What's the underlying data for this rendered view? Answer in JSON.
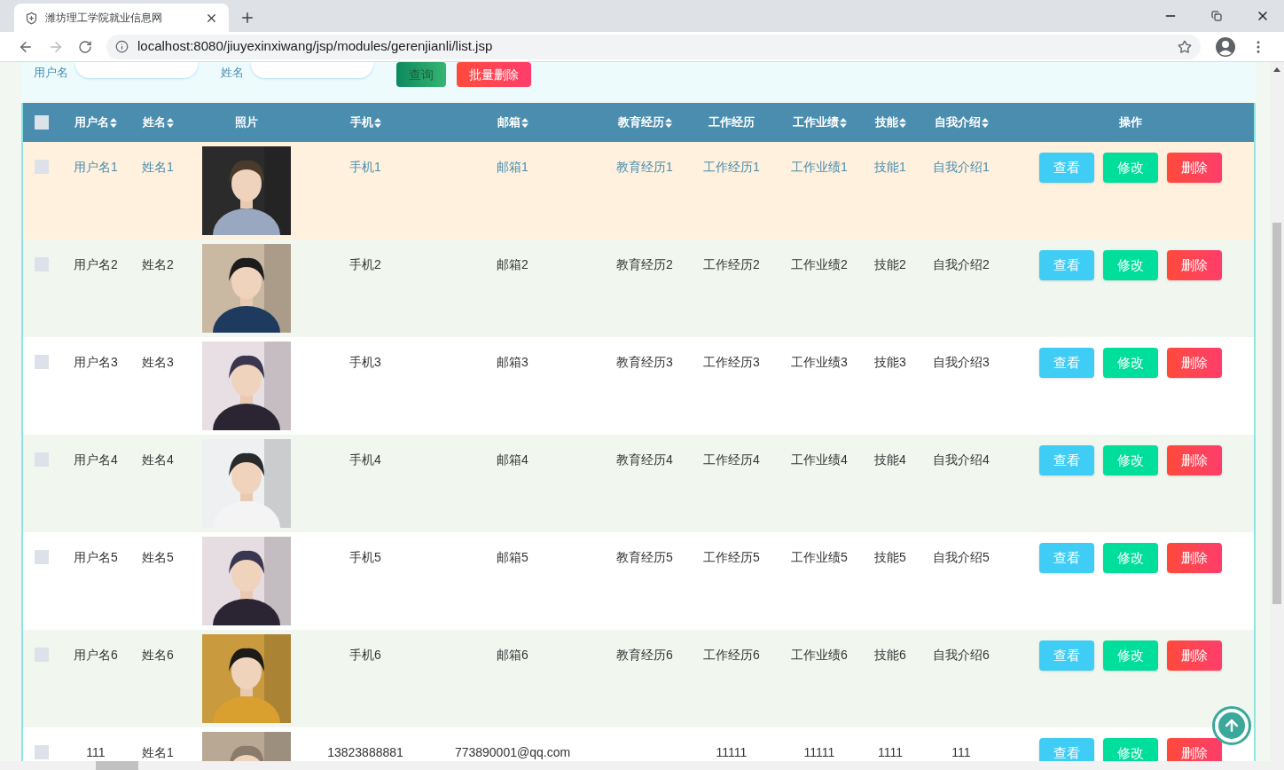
{
  "browser": {
    "tab_title": "潍坊理工学院就业信息网",
    "url": "localhost:8080/jiuyexinxiwang/jsp/modules/gerenjianli/list.jsp"
  },
  "search": {
    "fields": [
      {
        "label": "用户名"
      },
      {
        "label": "姓名"
      }
    ],
    "buttons": [
      {
        "label": "查询",
        "kind": "search"
      },
      {
        "label": "批量删除",
        "kind": "delete"
      }
    ]
  },
  "table": {
    "header_checkbox": {
      "checked": false
    },
    "columns": [
      {
        "label": "用户名",
        "sortable": true
      },
      {
        "label": "姓名",
        "sortable": true
      },
      {
        "label": "照片",
        "sortable": false
      },
      {
        "label": "手机",
        "sortable": true
      },
      {
        "label": "邮箱",
        "sortable": true
      },
      {
        "label": "教育经历",
        "sortable": true
      },
      {
        "label": "工作经历",
        "sortable": false
      },
      {
        "label": "工作业绩",
        "sortable": true
      },
      {
        "label": "技能",
        "sortable": true
      },
      {
        "label": "自我介绍",
        "sortable": true
      },
      {
        "label": "操作",
        "sortable": false
      }
    ],
    "rows": [
      {
        "hovered": true,
        "checked": false,
        "cells": {
          "username": "用户名1",
          "name": "姓名1",
          "phone": "手机1",
          "email": "邮箱1",
          "education": "教育经历1",
          "work": "工作经历1",
          "performance": "工作业绩1",
          "skills": "技能1",
          "intro": "自我介绍1"
        },
        "actions": [
          {
            "label": "查看",
            "kind": "view"
          },
          {
            "label": "修改",
            "kind": "edit"
          },
          {
            "label": "删除",
            "kind": "delete"
          }
        ]
      },
      {
        "hovered": false,
        "checked": false,
        "cells": {
          "username": "用户名2",
          "name": "姓名2",
          "phone": "手机2",
          "email": "邮箱2",
          "education": "教育经历2",
          "work": "工作经历2",
          "performance": "工作业绩2",
          "skills": "技能2",
          "intro": "自我介绍2"
        },
        "actions": [
          {
            "label": "查看",
            "kind": "view"
          },
          {
            "label": "修改",
            "kind": "edit"
          },
          {
            "label": "删除",
            "kind": "delete"
          }
        ]
      },
      {
        "hovered": false,
        "checked": false,
        "cells": {
          "username": "用户名3",
          "name": "姓名3",
          "phone": "手机3",
          "email": "邮箱3",
          "education": "教育经历3",
          "work": "工作经历3",
          "performance": "工作业绩3",
          "skills": "技能3",
          "intro": "自我介绍3"
        },
        "actions": [
          {
            "label": "查看",
            "kind": "view"
          },
          {
            "label": "修改",
            "kind": "edit"
          },
          {
            "label": "删除",
            "kind": "delete"
          }
        ]
      },
      {
        "hovered": false,
        "checked": false,
        "cells": {
          "username": "用户名4",
          "name": "姓名4",
          "phone": "手机4",
          "email": "邮箱4",
          "education": "教育经历4",
          "work": "工作经历4",
          "performance": "工作业绩4",
          "skills": "技能4",
          "intro": "自我介绍4"
        },
        "actions": [
          {
            "label": "查看",
            "kind": "view"
          },
          {
            "label": "修改",
            "kind": "edit"
          },
          {
            "label": "删除",
            "kind": "delete"
          }
        ]
      },
      {
        "hovered": false,
        "checked": false,
        "cells": {
          "username": "用户名5",
          "name": "姓名5",
          "phone": "手机5",
          "email": "邮箱5",
          "education": "教育经历5",
          "work": "工作经历5",
          "performance": "工作业绩5",
          "skills": "技能5",
          "intro": "自我介绍5"
        },
        "actions": [
          {
            "label": "查看",
            "kind": "view"
          },
          {
            "label": "修改",
            "kind": "edit"
          },
          {
            "label": "删除",
            "kind": "delete"
          }
        ]
      },
      {
        "hovered": false,
        "checked": false,
        "cells": {
          "username": "用户名6",
          "name": "姓名6",
          "phone": "手机6",
          "email": "邮箱6",
          "education": "教育经历6",
          "work": "工作经历6",
          "performance": "工作业绩6",
          "skills": "技能6",
          "intro": "自我介绍6"
        },
        "actions": [
          {
            "label": "查看",
            "kind": "view"
          },
          {
            "label": "修改",
            "kind": "edit"
          },
          {
            "label": "删除",
            "kind": "delete"
          }
        ]
      },
      {
        "hovered": false,
        "checked": false,
        "cells": {
          "username": "111",
          "name": "姓名1",
          "phone": "13823888881",
          "email": "773890001@qq.com",
          "work": "11111",
          "performance": "11111",
          "skills": "1111",
          "intro": "111"
        },
        "actions": [
          {
            "label": "查看",
            "kind": "view"
          },
          {
            "label": "修改",
            "kind": "edit"
          },
          {
            "label": "删除",
            "kind": "delete"
          }
        ]
      }
    ]
  }
}
